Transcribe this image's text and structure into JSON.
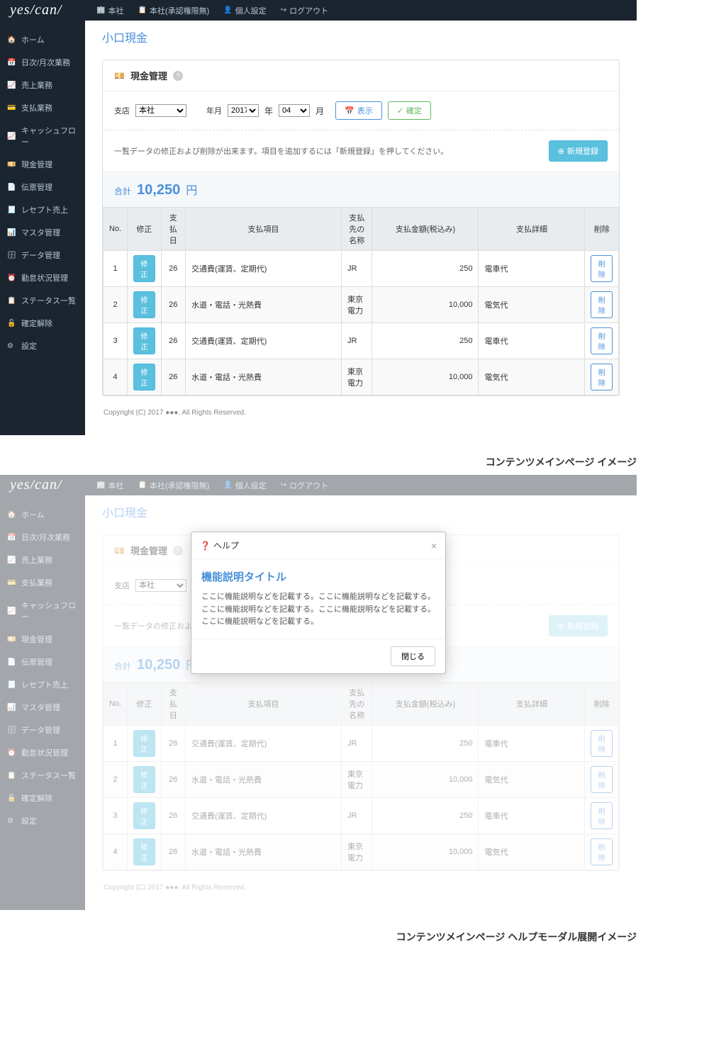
{
  "logo": "yes/can/",
  "header_nav": [
    {
      "icon": "🏢",
      "label": "本社"
    },
    {
      "icon": "📋",
      "label": "本社(承認権限無)"
    },
    {
      "icon": "👤",
      "label": "個人設定"
    },
    {
      "icon": "↪",
      "label": "ログアウト"
    }
  ],
  "sidebar": [
    {
      "icon": "🏠",
      "label": "ホーム"
    },
    {
      "icon": "📅",
      "label": "日次/月次業務"
    },
    {
      "icon": "📈",
      "label": "売上業務"
    },
    {
      "icon": "💳",
      "label": "支払業務"
    },
    {
      "icon": "📈",
      "label": "キャッシュフロー"
    },
    {
      "icon": "💴",
      "label": "現金管理"
    },
    {
      "icon": "📄",
      "label": "伝票管理"
    },
    {
      "icon": "🧾",
      "label": "レセプト売上"
    },
    {
      "icon": "📊",
      "label": "マスタ管理"
    },
    {
      "icon": "🗄",
      "label": "データ管理"
    },
    {
      "icon": "⏰",
      "label": "勤怠状況管理"
    },
    {
      "icon": "📋",
      "label": "ステータス一覧"
    },
    {
      "icon": "🔓",
      "label": "確定解除"
    },
    {
      "icon": "⚙",
      "label": "設定"
    }
  ],
  "page_title": "小口現金",
  "panel": {
    "title": "現金管理",
    "filter": {
      "branch_label": "支店",
      "branch_value": "本社",
      "ym_label": "年月",
      "year_value": "2017",
      "year_suffix": "年",
      "month_value": "04",
      "month_suffix": "月",
      "show_btn": "表示",
      "confirm_btn": "確定"
    },
    "note": "一覧データの修正および削除が出来ます。項目を追加するには「新規登録」を押してください。",
    "new_btn": "新規登録",
    "total_label": "合計",
    "total_value": "10,250",
    "total_unit": "円",
    "columns": [
      "No.",
      "修正",
      "支払日",
      "支払項目",
      "支払先の名称",
      "支払金額(税込み)",
      "支払詳細",
      "削除"
    ],
    "edit_btn": "修正",
    "delete_btn": "削除",
    "rows": [
      {
        "no": "1",
        "date": "26",
        "item": "交通費(運賃、定期代)",
        "payee": "JR",
        "amount": "250",
        "detail": "電車代"
      },
      {
        "no": "2",
        "date": "26",
        "item": "水道・電話・光熱費",
        "payee": "東京電力",
        "amount": "10,000",
        "detail": "電気代"
      },
      {
        "no": "3",
        "date": "26",
        "item": "交通費(運賃、定期代)",
        "payee": "JR",
        "amount": "250",
        "detail": "電車代"
      },
      {
        "no": "4",
        "date": "26",
        "item": "水道・電話・光熱費",
        "payee": "東京電力",
        "amount": "10,000",
        "detail": "電気代"
      }
    ]
  },
  "copyright": "Copyright (C) 2017 ●●●. All Rights Reserved.",
  "modal": {
    "header": "ヘルプ",
    "title": "機能説明タイトル",
    "body": "ここに機能説明などを記載する。ここに機能説明などを記載する。ここに機能説明などを記載する。ここに機能説明などを記載する。ここに機能説明などを記載する。",
    "close": "閉じる"
  },
  "captions": {
    "a": "コンテンツメインページ イメージ",
    "b": "コンテンツメインページ ヘルプモーダル展開イメージ"
  }
}
